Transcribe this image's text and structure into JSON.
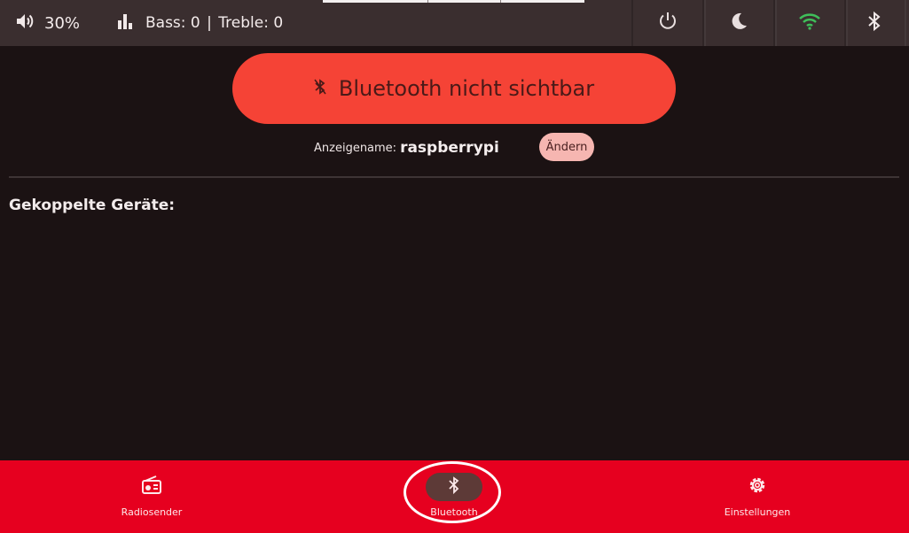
{
  "status_bar": {
    "volume": "30%",
    "bass": "Bass: 0",
    "separator": "|",
    "treble": "Treble: 0",
    "wifi_color": "#3fbf5a"
  },
  "main": {
    "bluetooth_status": "Bluetooth nicht sichtbar",
    "display_name_label": "Anzeigename:",
    "display_name_value": "raspberrypi",
    "change_button": "Ändern",
    "paired_devices_title": "Gekoppelte Geräte:",
    "accent_color": "#f54336"
  },
  "bottom_nav": {
    "items": [
      {
        "label": "Radiosender",
        "icon": "radio-icon"
      },
      {
        "label": "Bluetooth",
        "icon": "bluetooth-icon",
        "active": true
      },
      {
        "label": "Einstellungen",
        "icon": "gear-icon"
      }
    ],
    "background": "#e6001f"
  }
}
